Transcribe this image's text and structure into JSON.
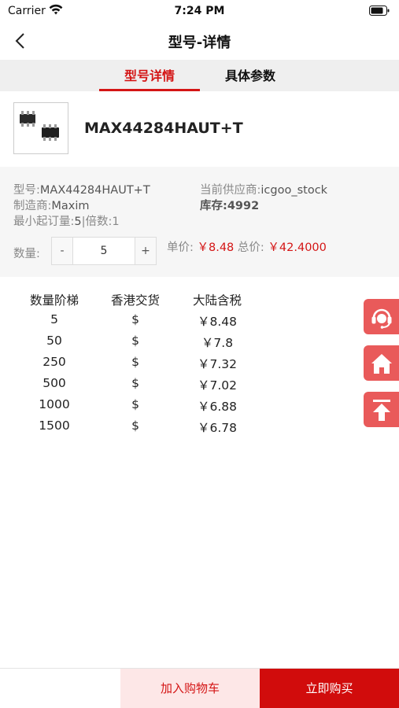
{
  "status_bar": {
    "carrier": "Carrier",
    "time": "7:24 PM",
    "wifi_icon": "wifi-icon",
    "battery_icon": "battery-icon"
  },
  "nav": {
    "title": "型号-详情",
    "back_icon": "chevron-left-icon"
  },
  "tabs": [
    {
      "label": "型号详情",
      "active": true
    },
    {
      "label": "具体参数",
      "active": false
    }
  ],
  "product": {
    "name": "MAX44284HAUT+T",
    "image": "ic-chip-image"
  },
  "info": {
    "model_label": "型号:",
    "model_value": "MAX44284HAUT+T",
    "supplier_label": "当前供应商:",
    "supplier_value": "icgoo_stock",
    "maker_label": "制造商:",
    "maker_value": "Maxim",
    "stock_label": "库存:",
    "stock_value": "4992",
    "min_order_label": "最小起订量:",
    "min_order_value": "5",
    "multiple_label": "|倍数:",
    "multiple_value": "1"
  },
  "quantity": {
    "label": "数量:",
    "minus": "-",
    "value": "5",
    "plus": "+"
  },
  "pricing": {
    "unit_label": "单价:",
    "unit_value": "￥8.48",
    "total_label": "总价:",
    "total_value": "￥42.4000"
  },
  "price_table": {
    "headers": [
      "数量阶梯",
      "香港交货",
      "大陆含税"
    ],
    "rows": [
      [
        "5",
        "$",
        "￥8.48"
      ],
      [
        "50",
        "$",
        "￥7.8"
      ],
      [
        "250",
        "$",
        "￥7.32"
      ],
      [
        "500",
        "$",
        "￥7.02"
      ],
      [
        "1000",
        "$",
        "￥6.88"
      ],
      [
        "1500",
        "$",
        "￥6.78"
      ]
    ]
  },
  "side_buttons": [
    {
      "icon": "customer-service-icon"
    },
    {
      "icon": "home-icon"
    },
    {
      "icon": "back-to-top-icon"
    }
  ],
  "bottom_bar": {
    "add_cart": "加入购物车",
    "buy_now": "立即购买"
  },
  "colors": {
    "accent": "#d41515",
    "float_button": "#e95a5a",
    "buy_button": "#d10c0c",
    "cart_button_bg": "#fde7e7"
  }
}
